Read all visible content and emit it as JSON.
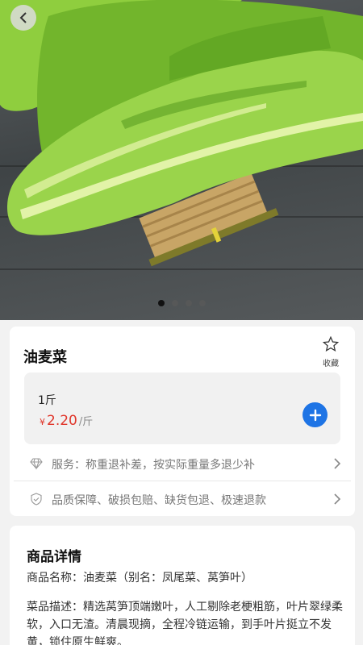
{
  "hero": {
    "slide_count": 4,
    "active_slide": 1
  },
  "product": {
    "name": "油麦菜",
    "favorite_label": "收藏",
    "spec": "1斤",
    "currency": "¥",
    "price": "2.20",
    "unit": "/斤"
  },
  "services": [
    {
      "icon": "diamond-icon",
      "text": "服务：称重退补差，按实际重量多退少补"
    },
    {
      "icon": "shield-check-icon",
      "text": "品质保障、破损包赔、缺货包退、极速退款"
    }
  ],
  "detail": {
    "title": "商品详情",
    "name_line": "商品名称：油麦菜（别名：凤尾菜、莴笋叶）",
    "description": "菜品描述：精选莴笋顶端嫩叶，人工剔除老梗粗筋，叶片翠绿柔软，入口无渣。清晨现摘，全程冷链运输，到手叶片挺立不发黄，锁住原生鲜爽。"
  },
  "colors": {
    "price": "#e0362b",
    "accent_button": "#1e74e5"
  }
}
